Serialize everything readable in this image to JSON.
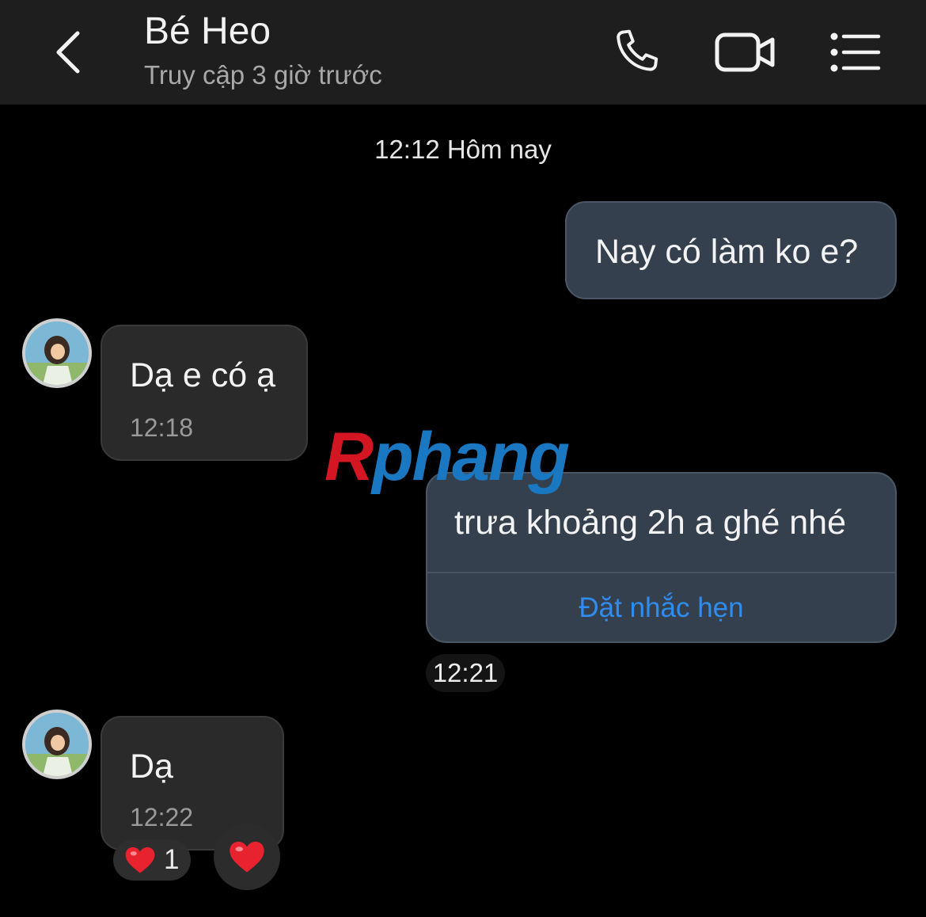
{
  "header": {
    "contact_name": "Bé Heo",
    "status": "Truy cập 3 giờ trước",
    "icons": [
      "back-chevron-icon",
      "phone-icon",
      "video-camera-icon",
      "menu-list-icon"
    ]
  },
  "chat": {
    "day_label": "12:12 Hôm nay",
    "messages": [
      {
        "direction": "outgoing",
        "text": "Nay có làm ko e?"
      },
      {
        "direction": "incoming",
        "text": "Dạ e có ạ",
        "time": "12:18"
      },
      {
        "direction": "outgoing",
        "text": "trưa khoảng 2h a ghé nhé",
        "action": "Đặt nhắc hẹn",
        "time": "12:21"
      },
      {
        "direction": "incoming",
        "text": "Dạ",
        "time": "12:22",
        "reaction": {
          "emoji": "heart",
          "count": "1"
        }
      }
    ]
  },
  "watermark": {
    "first": "R",
    "rest": "phang"
  },
  "colors": {
    "header_bg": "#1e1e1e",
    "outgoing_bubble": "#34404e",
    "incoming_bubble": "#2a2a2a",
    "link_blue": "#2f8cf0",
    "heart_red": "#e8232f"
  }
}
